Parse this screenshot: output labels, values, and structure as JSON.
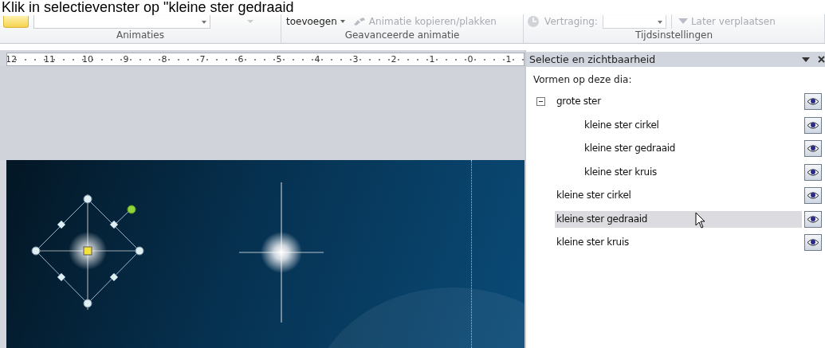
{
  "caption": "Klik in selectievenster op \"kleine ster gedraaid",
  "ribbon_groups": [
    {
      "label": "Animaties",
      "items": [
        {
          "kind": "gallery"
        },
        {
          "kind": "dropdown"
        }
      ]
    },
    {
      "label": "Geavanceerde animatie",
      "items": [
        {
          "kind": "menu-button",
          "label": "toevoegen",
          "disabled": false
        },
        {
          "kind": "button",
          "label": "Animatie kopieren/plakken",
          "disabled": true
        }
      ]
    },
    {
      "label": "Tijdsinstellingen",
      "items": [
        {
          "kind": "field",
          "label": "Vertraging:",
          "disabled": true
        },
        {
          "kind": "button",
          "label": "Later verplaatsen",
          "disabled": true
        }
      ]
    }
  ],
  "ruler": {
    "ticks": [
      "12",
      "11",
      "10",
      "9",
      "8",
      "7",
      "6",
      "5",
      "4",
      "3",
      "2",
      "1",
      "0",
      "1"
    ]
  },
  "pane": {
    "title": "Selectie en zichtbaarheid",
    "heading": "Vormen op deze dia:",
    "items": [
      {
        "label": "grote ster",
        "visible": true,
        "selected": false,
        "expanded": true,
        "children": [
          {
            "label": "kleine ster cirkel",
            "visible": true,
            "selected": false
          },
          {
            "label": "kleine ster gedraaid",
            "visible": true,
            "selected": false
          },
          {
            "label": "kleine ster kruis",
            "visible": true,
            "selected": false
          }
        ]
      },
      {
        "label": "kleine ster cirkel",
        "visible": true,
        "selected": false
      },
      {
        "label": "kleine ster gedraaid",
        "visible": true,
        "selected": true
      },
      {
        "label": "kleine ster kruis",
        "visible": true,
        "selected": false
      }
    ]
  }
}
